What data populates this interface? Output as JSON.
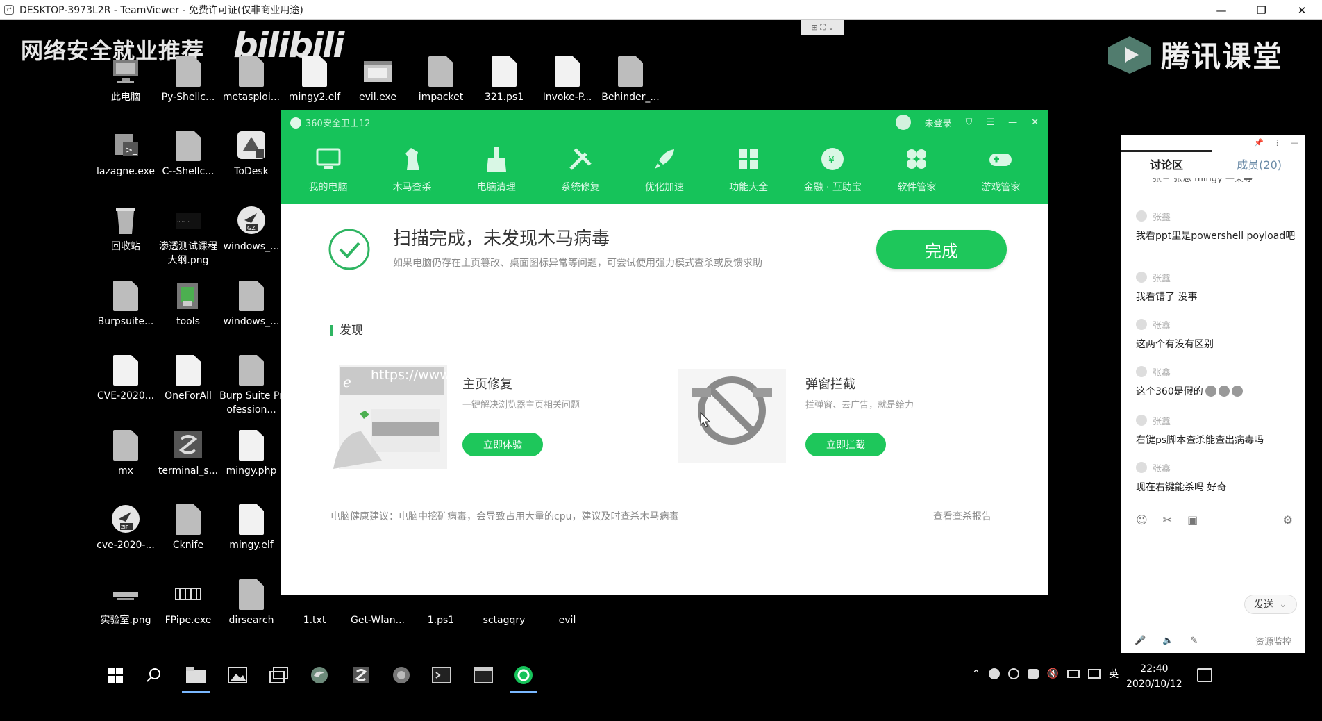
{
  "titlebar": {
    "title": "DESKTOP-3973L2R - TeamViewer - 免费许可证(仅非商业用途)",
    "min": "—",
    "max": "❐",
    "close": "✕"
  },
  "toolbar_handle": {
    "icons": "⊞ ⛶ ⌄"
  },
  "overlays": {
    "left_text": "网络安全就业推荐",
    "bili_text": "bilibili",
    "tencent_text": "腾讯课堂"
  },
  "desktop": {
    "icons": [
      {
        "label": "此电脑"
      },
      {
        "label": "Py-Shellc..."
      },
      {
        "label": "metasploi..."
      },
      {
        "label": "mingy2.elf"
      },
      {
        "label": "evil.exe"
      },
      {
        "label": "impacket"
      },
      {
        "label": "321.ps1"
      },
      {
        "label": "Invoke-P..."
      },
      {
        "label": "Behinder_..."
      },
      {
        "label": "lazagne.exe"
      },
      {
        "label": "C--Shellc..."
      },
      {
        "label": "ToDesk"
      },
      {
        "label": "回收站"
      },
      {
        "label": "渗透测试课程大纲.png"
      },
      {
        "label": "windows_..."
      },
      {
        "label": "Burpsuite..."
      },
      {
        "label": "tools"
      },
      {
        "label": "windows_..."
      },
      {
        "label": "CVE-2020..."
      },
      {
        "label": "OneForAll"
      },
      {
        "label": "Burp Suite Profession..."
      },
      {
        "label": "mx"
      },
      {
        "label": "terminal_s..."
      },
      {
        "label": "mingy.php"
      },
      {
        "label": "cve-2020-..."
      },
      {
        "label": "Cknife"
      },
      {
        "label": "mingy.elf"
      },
      {
        "label": "实验室.png"
      },
      {
        "label": "FPipe.exe"
      },
      {
        "label": "dirsearch"
      },
      {
        "label": "1.txt"
      },
      {
        "label": "Get-Wlan..."
      },
      {
        "label": "1.ps1"
      },
      {
        "label": "sctagqry"
      },
      {
        "label": "evil"
      }
    ]
  },
  "app360": {
    "title": "360安全卫士12",
    "login": "未登录",
    "nav": [
      {
        "label": "我的电脑"
      },
      {
        "label": "木马查杀"
      },
      {
        "label": "电脑清理"
      },
      {
        "label": "系统修复"
      },
      {
        "label": "优化加速"
      },
      {
        "label": "功能大全"
      },
      {
        "label": "金融 · 互助宝"
      },
      {
        "label": "软件管家"
      },
      {
        "label": "游戏管家"
      }
    ],
    "scan_title": "扫描完成，未发现木马病毒",
    "scan_sub": "如果电脑仍存在主页篡改、桌面图标异常等问题，可尝试使用强力模式查杀或反馈求助",
    "done_button": "完成",
    "section_label": "发现",
    "feature1": {
      "url_text": "https://www",
      "title": "主页修复",
      "subtitle": "一键解决浏览器主页相关问题",
      "button": "立即体验"
    },
    "feature2": {
      "title": "弹窗拦截",
      "subtitle": "拦弹窗、去广告，就是给力",
      "button": "立即拦截"
    },
    "health_tip": "电脑健康建议：电脑中挖矿病毒，会导致占用大量的cpu，建议及时查杀木马病毒",
    "report_link": "查看查杀报告",
    "colors": {
      "green": "#16c35a",
      "button_green": "#1ec75b"
    }
  },
  "panel": {
    "pin": "📌",
    "more": "⋮",
    "minimize": "—",
    "tab_discussion": "讨论区",
    "tab_members": "成员(20)",
    "clipped_text": "张三 张思 mingy 一某等",
    "messages": [
      {
        "author": "张鑫",
        "text": "我看ppt里是powershell poyload吧"
      },
      {
        "author": "张鑫",
        "text": "我看错了 没事"
      },
      {
        "author": "张鑫",
        "text": "这两个有没有区别"
      },
      {
        "author": "张鑫",
        "text": "这个360是假的"
      },
      {
        "author": "张鑫",
        "text": "右键ps脚本查杀能查出病毒吗"
      },
      {
        "author": "张鑫",
        "text": "现在右键能杀吗 好奇"
      }
    ],
    "tools": {
      "emoji": "☺",
      "scissors": "✂",
      "image": "▣",
      "settings": "⚙"
    },
    "send": "发送",
    "send_arrow": "⌄",
    "bottom": {
      "mic": "🎤",
      "speaker": "🔈",
      "mark": "✎",
      "resource": "资源监控"
    }
  },
  "taskbar": {
    "tray": {
      "chevron": "⌃",
      "lang": "英",
      "mute": "🔇"
    },
    "time": "22:40",
    "date": "2020/10/12"
  }
}
